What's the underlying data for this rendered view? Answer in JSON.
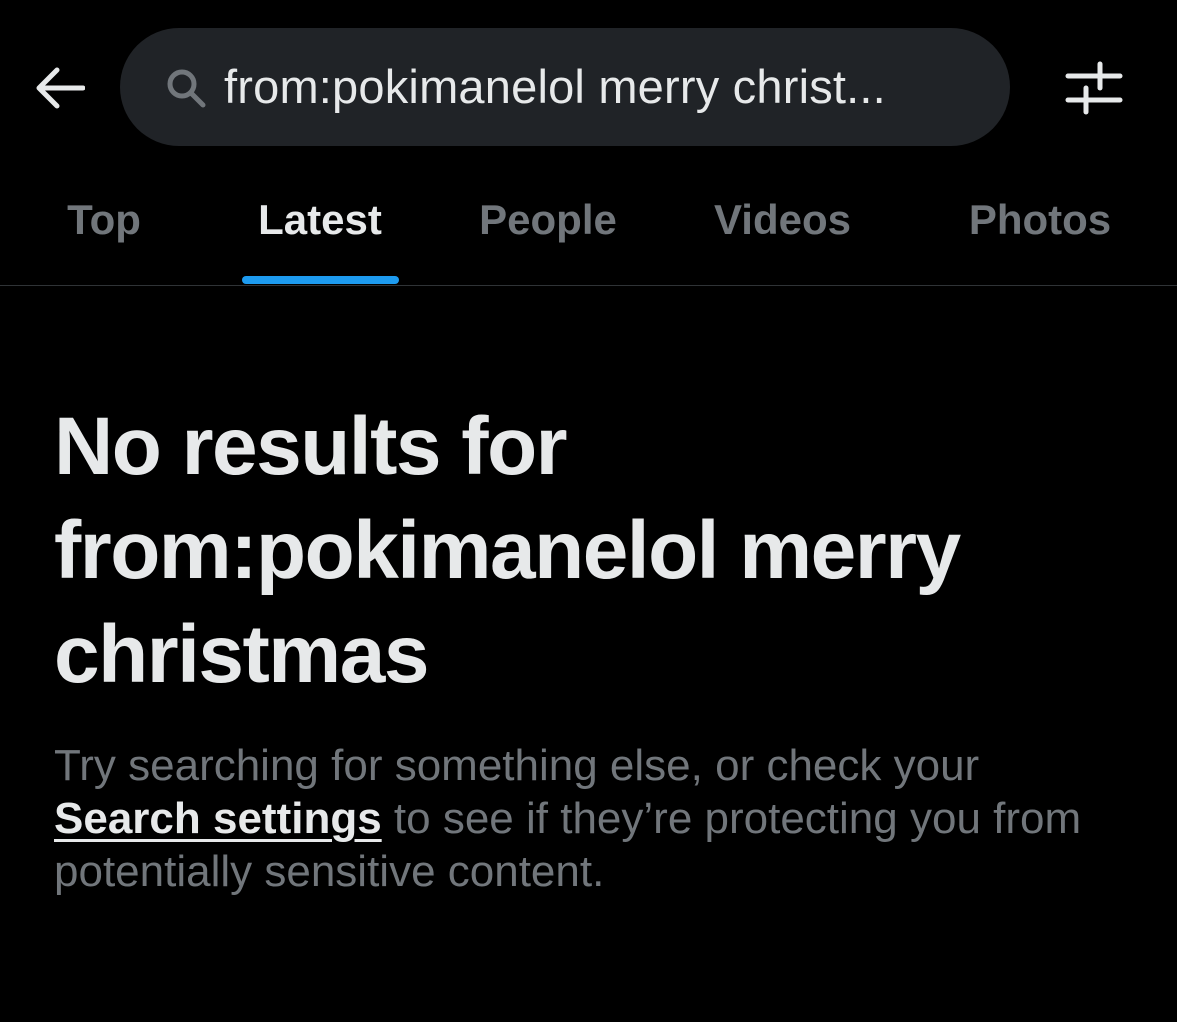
{
  "header": {
    "back_icon": "arrow-left-icon",
    "search": {
      "icon": "search-icon",
      "value": "from:pokimanelol merry christ..."
    },
    "filter_icon": "sliders-icon"
  },
  "tabs": [
    {
      "label": "Top",
      "active": false
    },
    {
      "label": "Latest",
      "active": true
    },
    {
      "label": "People",
      "active": false
    },
    {
      "label": "Videos",
      "active": false
    },
    {
      "label": "Photos",
      "active": false
    }
  ],
  "empty_state": {
    "title": "No results for from:pokimanelol merry christmas",
    "body_prefix": "Try searching for something else, or check your ",
    "link_label": "Search settings",
    "body_suffix": " to see if they’re protecting you from potentially sensitive content."
  },
  "colors": {
    "background": "#000000",
    "primary_text": "#e7e9ea",
    "secondary_text": "#71767b",
    "accent": "#1d9bf0",
    "search_pill": "#202327",
    "divider": "#2f3336"
  }
}
